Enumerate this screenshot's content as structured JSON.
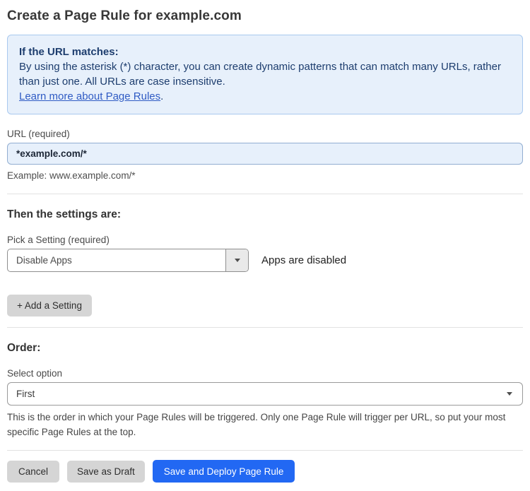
{
  "page": {
    "title": "Create a Page Rule for example.com"
  },
  "info_box": {
    "heading": "If the URL matches:",
    "body": "By using the asterisk (*) character, you can create dynamic patterns that can match many URLs, rather than just one. All URLs are case insensitive.",
    "link_label": "Learn more about Page Rules",
    "link_suffix": "."
  },
  "url_field": {
    "label": "URL (required)",
    "value": "*example.com/*",
    "helper": "Example: www.example.com/*"
  },
  "settings_section": {
    "heading": "Then the settings are:",
    "picker_label": "Pick a Setting (required)",
    "selected_setting": "Disable Apps",
    "status_text": "Apps are disabled",
    "add_setting_label": "+ Add a Setting"
  },
  "order_section": {
    "heading": "Order:",
    "select_label": "Select option",
    "selected_option": "First",
    "helper": "This is the order in which your Page Rules will be triggered. Only one Page Rule will trigger per URL, so put your most specific Page Rules at the top."
  },
  "actions": {
    "cancel_label": "Cancel",
    "save_draft_label": "Save as Draft",
    "save_deploy_label": "Save and Deploy Page Rule"
  },
  "icons": {
    "dropdown_caret": "caret-down-triangle"
  },
  "colors": {
    "info_bg": "#e7f0fb",
    "info_border": "#a9c9ef",
    "info_text": "#1d3d6e",
    "link_blue": "#2f5bc4",
    "input_bg": "#e7f0fb",
    "input_border": "#92aed1",
    "primary_blue": "#2268f3",
    "button_gray": "#d5d5d5"
  }
}
